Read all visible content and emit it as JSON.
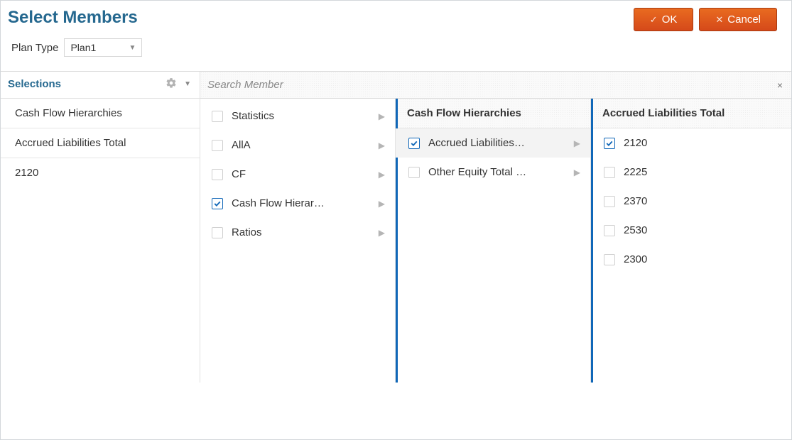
{
  "header": {
    "title": "Select Members",
    "ok_label": "OK",
    "cancel_label": "Cancel"
  },
  "planType": {
    "label": "Plan Type",
    "value": "Plan1"
  },
  "sidebar": {
    "title": "Selections",
    "items": [
      {
        "label": "Cash Flow Hierarchies"
      },
      {
        "label": "Accrued Liabilities Total"
      },
      {
        "label": "2120"
      }
    ]
  },
  "search": {
    "placeholder": "Search Member"
  },
  "col1": {
    "items": [
      {
        "label": "Statistics",
        "checked": false
      },
      {
        "label": "AllA",
        "checked": false
      },
      {
        "label": "CF",
        "checked": false
      },
      {
        "label": "Cash Flow Hierar…",
        "checked": true
      },
      {
        "label": "Ratios",
        "checked": false
      }
    ]
  },
  "col2": {
    "header": "Cash Flow Hierarchies",
    "items": [
      {
        "label": "Accrued Liabilities…",
        "checked": true,
        "selected": true
      },
      {
        "label": "Other Equity Total …",
        "checked": false,
        "selected": false
      }
    ]
  },
  "col3": {
    "header": "Accrued Liabilities Total",
    "items": [
      {
        "label": "2120",
        "checked": true
      },
      {
        "label": "2225",
        "checked": false
      },
      {
        "label": "2370",
        "checked": false
      },
      {
        "label": "2530",
        "checked": false
      },
      {
        "label": "2300",
        "checked": false
      }
    ]
  }
}
